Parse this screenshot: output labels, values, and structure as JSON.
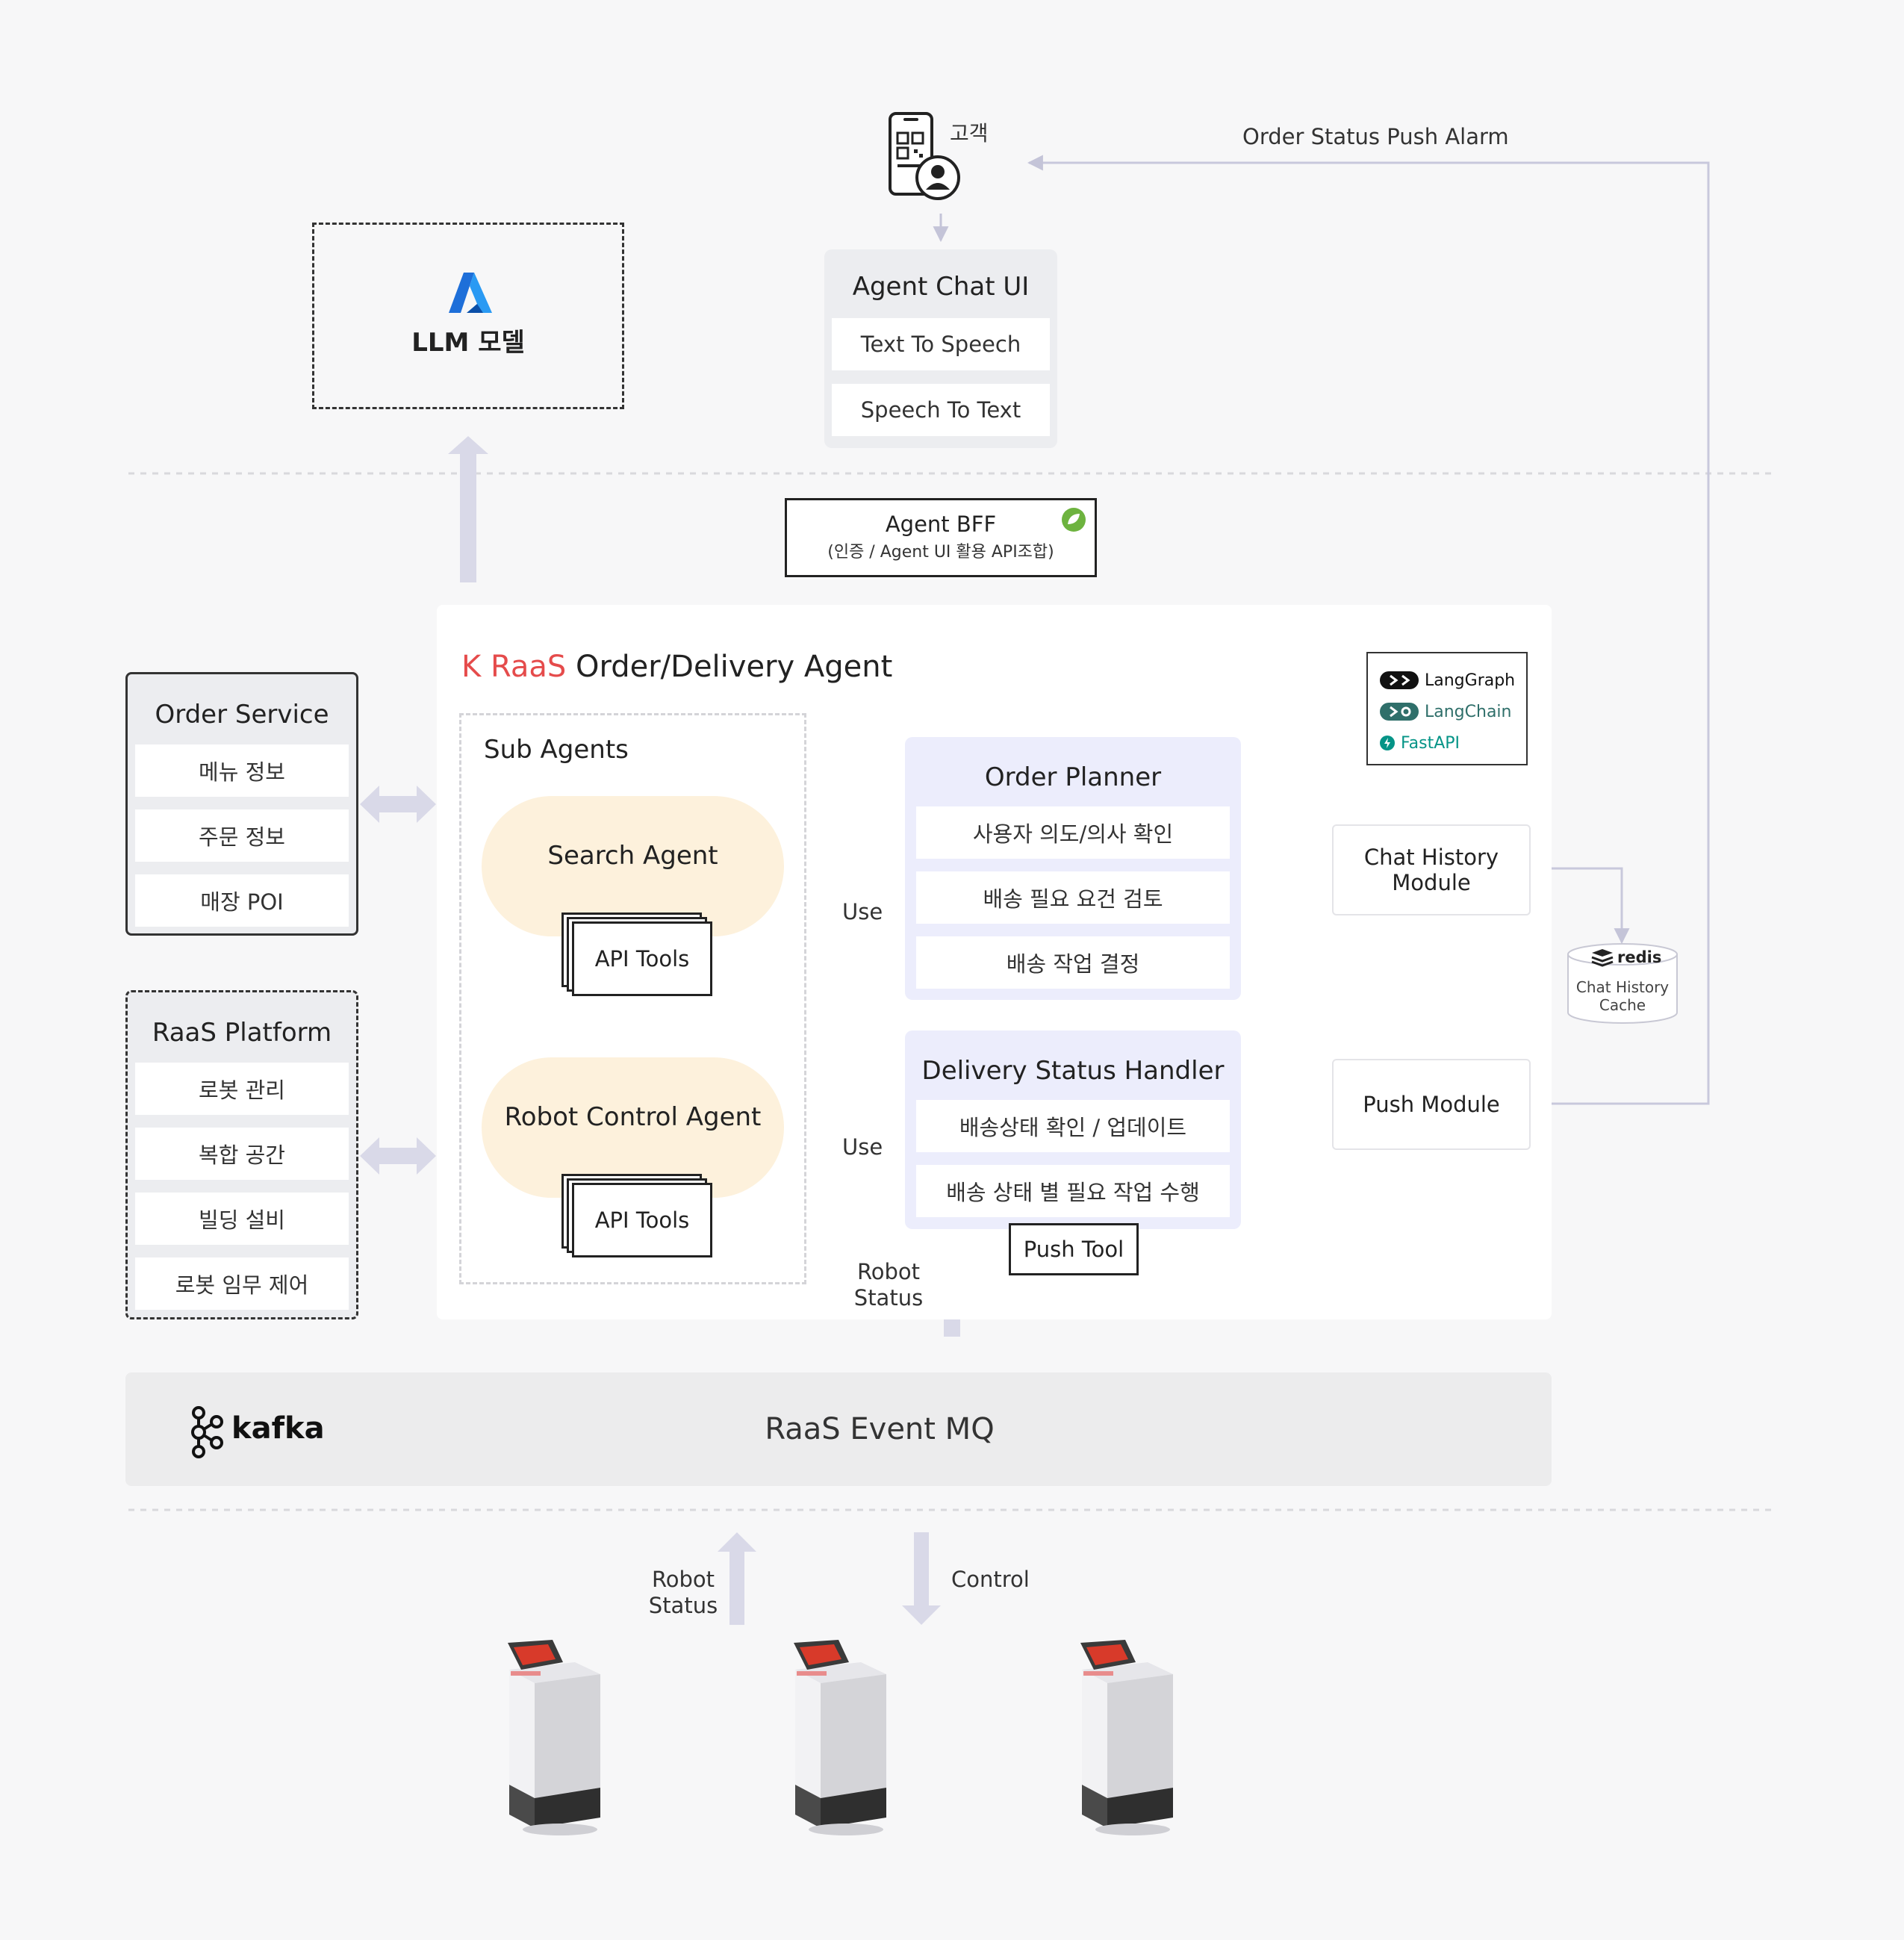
{
  "customer": {
    "label": "고객"
  },
  "push_alarm": {
    "label": "Order Status Push Alarm"
  },
  "llm": {
    "label": "LLM 모델"
  },
  "chat_ui": {
    "title": "Agent Chat UI",
    "items": [
      "Text To Speech",
      "Speech To Text"
    ]
  },
  "bff": {
    "title": "Agent BFF",
    "subtitle": "(인증 / Agent UI 활용 API조합)"
  },
  "agent": {
    "brand": "K RaaS",
    "title": "Order/Delivery Agent",
    "brand_color": "#e54b4b"
  },
  "frameworks": [
    "LangGraph",
    "LangChain",
    "FastAPI"
  ],
  "sub_agents": {
    "title": "Sub Agents",
    "search": {
      "label": "Search Agent",
      "tools": "API Tools"
    },
    "robot": {
      "label": "Robot Control Agent",
      "tools": "API Tools"
    }
  },
  "order_planner": {
    "title": "Order Planner",
    "items": [
      "사용자 의도/의사 확인",
      "배송 필요 요건 검토",
      "배송 작업 결정"
    ]
  },
  "delivery_handler": {
    "title": "Delivery Status Handler",
    "items": [
      "배송상태 확인 / 업데이트",
      "배송 상태 별 필요 작업 수행"
    ]
  },
  "push_tool": {
    "label": "Push Tool"
  },
  "use_labels": [
    "Use",
    "Use"
  ],
  "chat_history": {
    "label_1": "Chat History",
    "label_2": "Module"
  },
  "redis": {
    "brand": "redis",
    "label_1": "Chat History",
    "label_2": "Cache"
  },
  "push_module": {
    "label": "Push Module"
  },
  "order_service": {
    "title": "Order Service",
    "items": [
      "메뉴 정보",
      "주문 정보",
      "매장 POI"
    ]
  },
  "raas_platform": {
    "title": "RaaS Platform",
    "items": [
      "로봇 관리",
      "복합 공간",
      "빌딩 설비",
      "로봇 임무 제어"
    ]
  },
  "robot_status_mid": {
    "line1": "Robot",
    "line2": "Status"
  },
  "mq": {
    "brand": "kafka",
    "title": "RaaS Event MQ"
  },
  "robot_status_bottom": {
    "line1": "Robot",
    "line2": "Status"
  },
  "control": {
    "label": "Control"
  },
  "colors": {
    "arrow_fill": "#d9d9e8",
    "use_arrow": "#6b74e6",
    "panel": "#ecedfc",
    "agent_bubble": "#fdf1dc",
    "connector": "#c8c8dc"
  }
}
